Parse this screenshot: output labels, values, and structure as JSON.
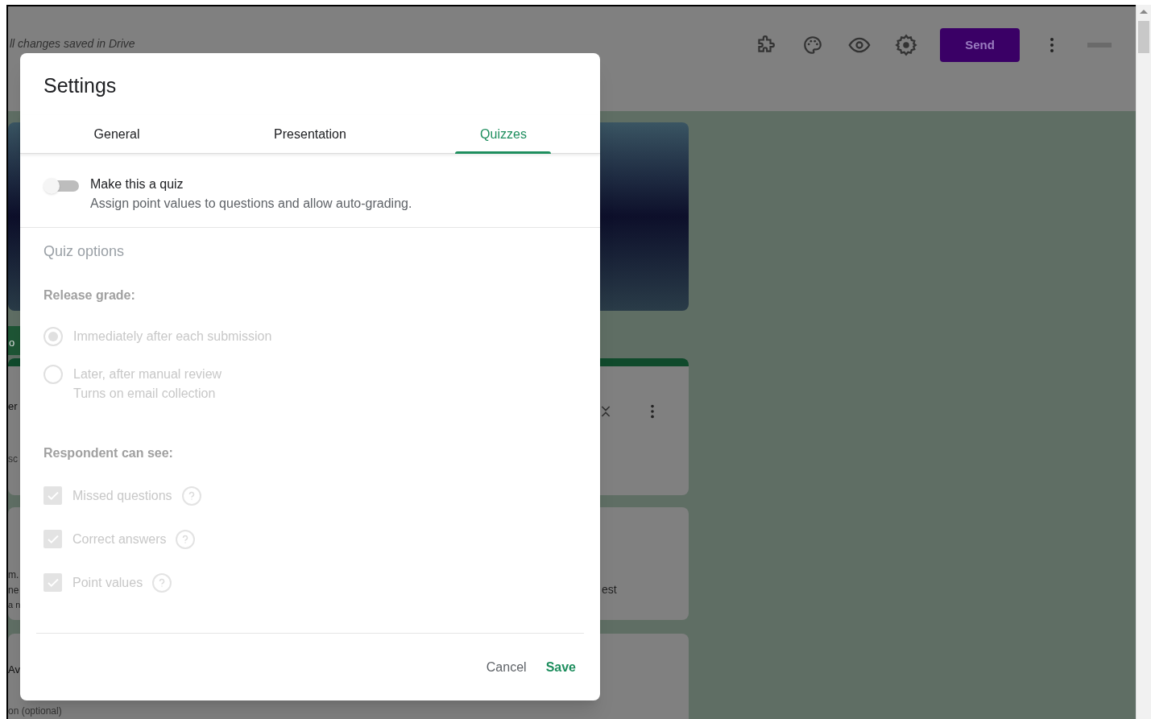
{
  "header": {
    "save_status": "ll changes saved in Drive",
    "send_button": "Send"
  },
  "background_fragments": [
    {
      "text": "o"
    },
    {
      "text": "er"
    },
    {
      "text": "sc"
    },
    {
      "text": "m."
    },
    {
      "text": "ne"
    },
    {
      "text": "a n"
    },
    {
      "text": "Av"
    },
    {
      "text": "on (optional)"
    }
  ],
  "card_text": "est",
  "dialog": {
    "title": "Settings",
    "tabs": [
      {
        "label": "General",
        "selected": false
      },
      {
        "label": "Presentation",
        "selected": false
      },
      {
        "label": "Quizzes",
        "selected": true
      }
    ],
    "quiz_toggle": {
      "label": "Make this a quiz",
      "description": "Assign point values to questions and allow auto-grading.",
      "on": false
    },
    "section_title": "Quiz options",
    "release_grade": {
      "label": "Release grade:",
      "disabled": true,
      "options": [
        {
          "label": "Immediately after each submission",
          "selected": true
        },
        {
          "label": "Later, after manual review",
          "description": "Turns on email collection",
          "selected": false
        }
      ]
    },
    "respondent_can_see": {
      "label": "Respondent can see:",
      "disabled": true,
      "options": [
        {
          "label": "Missed questions",
          "checked": true
        },
        {
          "label": "Correct answers",
          "checked": true
        },
        {
          "label": "Point values",
          "checked": true
        }
      ]
    },
    "buttons": [
      {
        "label": "Cancel",
        "kind": "secondary"
      },
      {
        "label": "Save",
        "kind": "primary"
      }
    ]
  }
}
